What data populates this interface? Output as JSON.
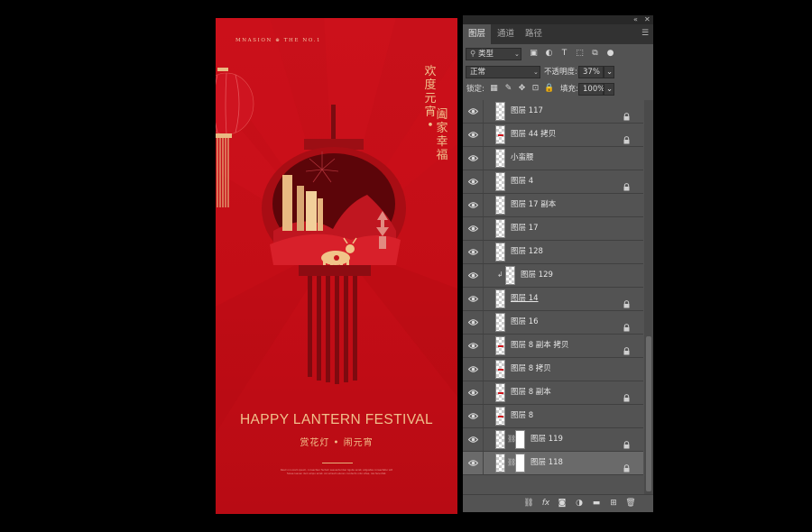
{
  "poster": {
    "brand": "MNASION ⊕ THE NO.1",
    "vertical_text_1": "欢度元宵",
    "vertical_sep": "•",
    "vertical_text_2": "阖家幸福",
    "title_en": "HAPPY LANTERN FESTIVAL",
    "title_cn": "赏花灯 • 闹元宵",
    "small_print": "Read on Lorem ipsum, consecteur factum assuante liber ligubu eniet, adgustes consectetur elit fuisse luenen dum ampo amet. Accumsam alucen condecto odio vitae, nisi feruntlat."
  },
  "panel": {
    "tabs": [
      {
        "label": "图层",
        "active": true
      },
      {
        "label": "通道",
        "active": false
      },
      {
        "label": "路径",
        "active": false
      }
    ],
    "filter_label": "类型",
    "blend_mode": "正常",
    "opacity_label": "不透明度:",
    "opacity_value": "37%",
    "lock_label": "锁定:",
    "fill_label": "填充:",
    "fill_value": "100%",
    "layers": [
      {
        "name": "图层 117",
        "locked": true,
        "thumb": "blank"
      },
      {
        "name": "图层 44 拷贝",
        "locked": true,
        "thumb": "red"
      },
      {
        "name": "小蛮腰",
        "locked": false,
        "thumb": "blank"
      },
      {
        "name": "图层 4",
        "locked": true,
        "thumb": "blank"
      },
      {
        "name": "图层 17 副本",
        "locked": false,
        "thumb": "blank"
      },
      {
        "name": "图层 17",
        "locked": false,
        "thumb": "blank"
      },
      {
        "name": "图层 128",
        "locked": false,
        "thumb": "blank"
      },
      {
        "name": "图层 129",
        "locked": false,
        "thumb": "blank",
        "clipped": true
      },
      {
        "name": "图层 14",
        "locked": true,
        "thumb": "blank",
        "underline": true
      },
      {
        "name": "图层 16",
        "locked": true,
        "thumb": "blank"
      },
      {
        "name": "图层 8 副本 拷贝",
        "locked": true,
        "thumb": "red"
      },
      {
        "name": "图层 8 拷贝",
        "locked": false,
        "thumb": "red"
      },
      {
        "name": "图层 8 副本",
        "locked": true,
        "thumb": "red"
      },
      {
        "name": "图层 8",
        "locked": false,
        "thumb": "red"
      },
      {
        "name": "图层 119",
        "locked": true,
        "thumb": "masked"
      },
      {
        "name": "图层 118",
        "locked": true,
        "thumb": "masked",
        "selected": true
      }
    ]
  },
  "colors": {
    "poster_red": "#c40d16",
    "gold": "#f0c18c",
    "panel_bg": "#535353",
    "panel_dark": "#323232"
  }
}
